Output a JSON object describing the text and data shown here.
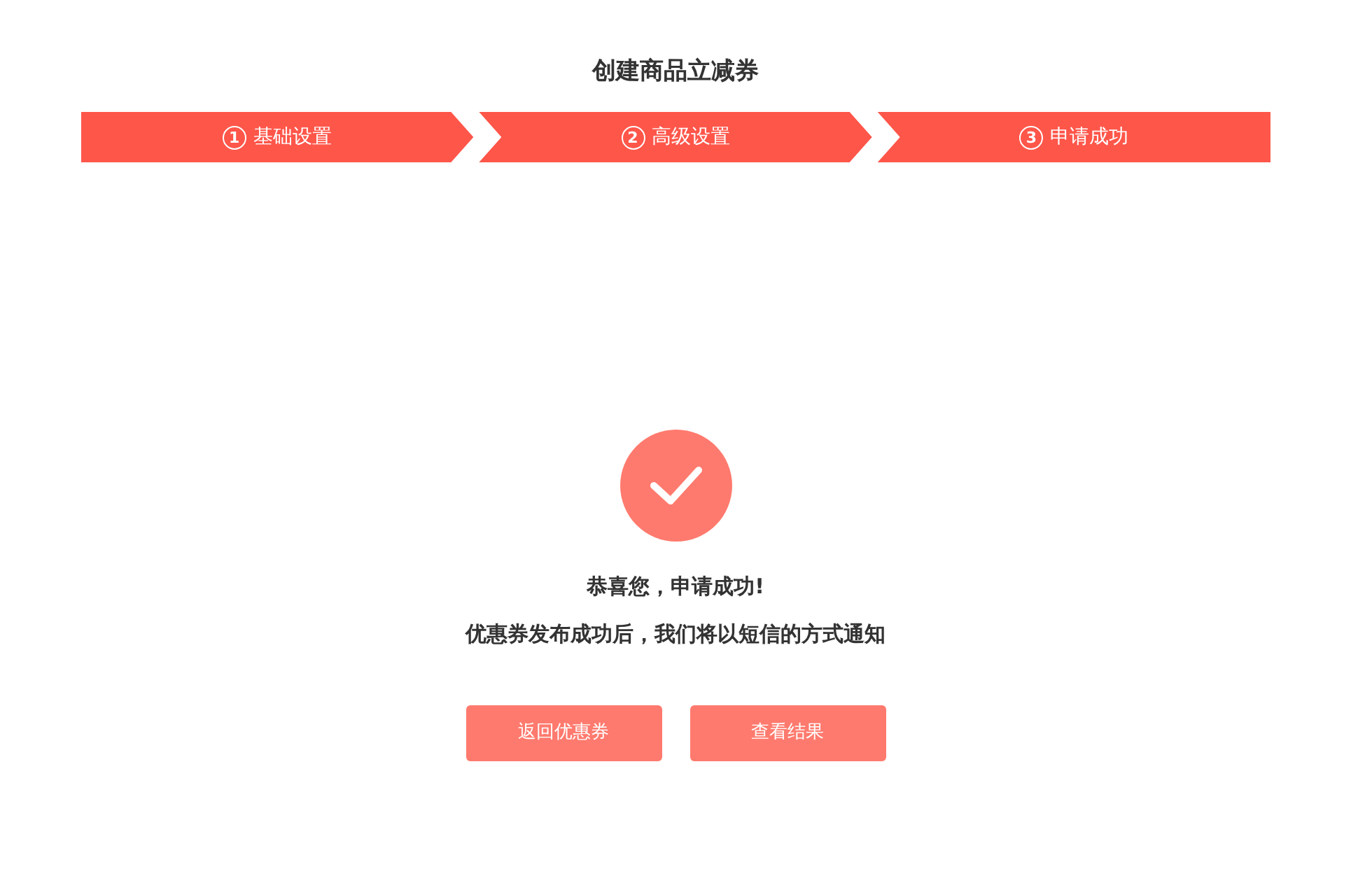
{
  "title": "创建商品立减券",
  "steps": [
    {
      "number": "1",
      "label": "基础设置",
      "kind": "first"
    },
    {
      "number": "2",
      "label": "高级设置",
      "kind": "middle"
    },
    {
      "number": "3",
      "label": "申请成功",
      "kind": "last"
    }
  ],
  "result": {
    "heading": "恭喜您，申请成功!",
    "message": "优惠券发布成功后，我们将以短信的方式通知"
  },
  "buttons": [
    "返回优惠券",
    "查看结果"
  ]
}
